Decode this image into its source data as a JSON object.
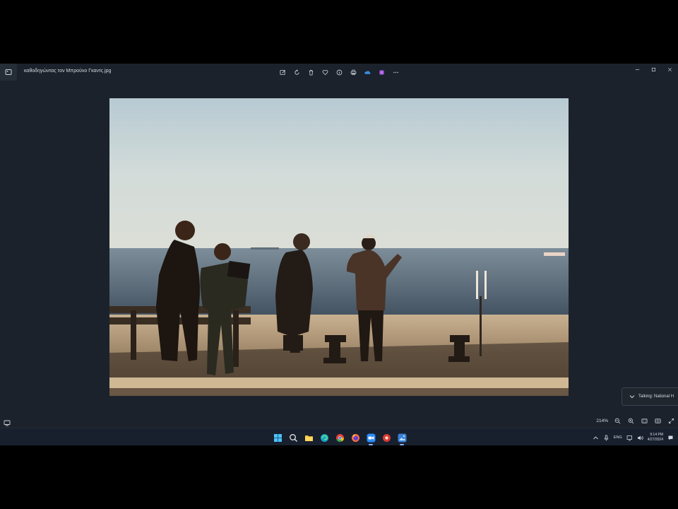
{
  "titlebar": {
    "file_name": "καθοδηγώντας τον Μπρούνο Γκαντς.jpg",
    "toolbar_icons": [
      "edit-icon",
      "rotate-icon",
      "delete-icon",
      "favorite-icon",
      "info-icon",
      "print-icon",
      "onedrive-icon",
      "copilot-icon",
      "more-icon"
    ],
    "window_controls": [
      "minimize-icon",
      "maximize-icon",
      "close-icon"
    ]
  },
  "toast": {
    "text": "Talking: National H"
  },
  "statusbar": {
    "zoom": "214%"
  },
  "taskbar": {
    "apps": [
      "start",
      "search",
      "file-explorer",
      "edge",
      "chrome",
      "firefox",
      "zoom",
      "app-red",
      "photos"
    ],
    "lang": "ENG",
    "time": "9:14 PM",
    "date": "4/27/2024"
  },
  "colors": {
    "app_bg": "#1b222b",
    "taskbar_bg": "#18202e",
    "accent": "#8ab4f8"
  }
}
